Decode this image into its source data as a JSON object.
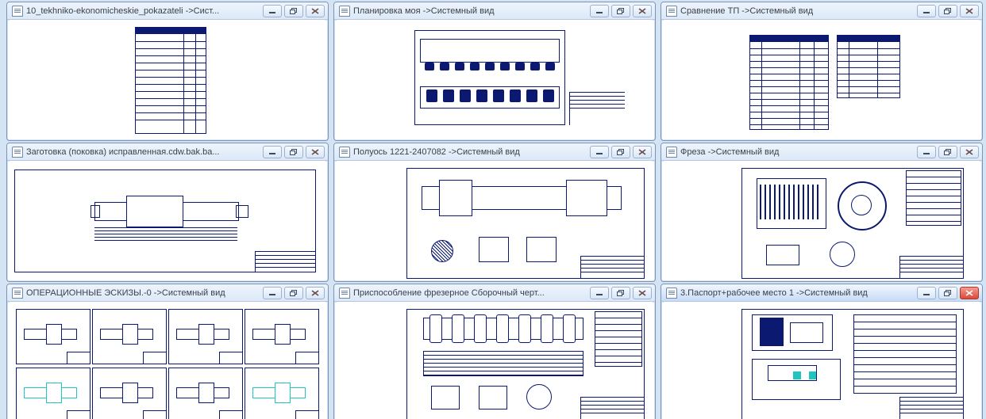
{
  "layout": {
    "cols": [
      8,
      420,
      832
    ],
    "rows": [
      2,
      180,
      358
    ],
    "win_w": 406,
    "win_h": 176
  },
  "windows": [
    {
      "title": "10_tekhniko-ekonomicheskie_pokazateli ->Сист...",
      "kind": "table1",
      "active": false
    },
    {
      "title": "Планировка моя ->Системный вид",
      "kind": "plan",
      "active": false
    },
    {
      "title": "Сравнение ТП ->Системный вид",
      "kind": "table2",
      "active": false
    },
    {
      "title": "Заготовка (поковка) исправленная.cdw.bak.ba...",
      "kind": "billet",
      "active": false
    },
    {
      "title": "Полуось 1221-2407082 ->Системный вид",
      "kind": "axle",
      "active": false
    },
    {
      "title": "Фреза ->Системный вид",
      "kind": "cutter",
      "active": false
    },
    {
      "title": "ОПЕРАЦИОННЫЕ ЭСКИЗЫ.-0 ->Системный вид",
      "kind": "sketches",
      "active": false
    },
    {
      "title": "Приспособление фрезерное Сборочный черт...",
      "kind": "fixture",
      "active": false
    },
    {
      "title": "3.Паспорт+рабочее место 1 ->Системный вид",
      "kind": "passport",
      "active": true
    }
  ],
  "btn": {
    "minimize_name": "minimize-icon",
    "restore_name": "restore-icon",
    "close_name": "close-icon"
  }
}
